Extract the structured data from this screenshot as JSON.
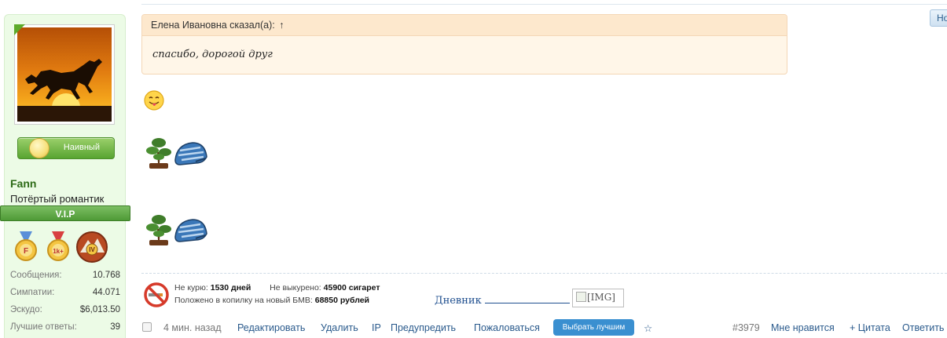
{
  "user": {
    "name": "Fann",
    "title": "Потёртый романтик",
    "mood_label": "Наивный",
    "rank_badge": "V.I.P",
    "stats": [
      {
        "label": "Сообщения:",
        "value": "10.768"
      },
      {
        "label": "Симпатии:",
        "value": "44.071"
      },
      {
        "label": "Эскудо:",
        "value": "$6,013.50"
      },
      {
        "label": "Лучшие ответы:",
        "value": "39"
      }
    ]
  },
  "quote": {
    "author_line": "Елена Ивановна сказал(а):",
    "arrow": "↑",
    "text": "спасибо, дорогой друг"
  },
  "top_right_button": "Но",
  "signature": {
    "not_smoking_label": "Не курю:",
    "not_smoking_value": "1530 дней",
    "not_smoked_label": "Не выкурено:",
    "not_smoked_value": "45900 сигарет",
    "saved_label": "Положено в копилку на новый БМВ:",
    "saved_value": "68850 рублей",
    "diary_label": "Дневник",
    "img_alt": "[IMG]"
  },
  "footer": {
    "time": "4 мин. назад",
    "edit": "Редактировать",
    "delete": "Удалить",
    "ip": "IP",
    "warn": "Предупредить",
    "report": "Пожаловаться",
    "best": "Выбрать лучшим",
    "star": "☆",
    "post_number": "#3979",
    "like": "Мне нравится",
    "quote": "+ Цитата",
    "reply": "Ответить"
  },
  "colors": {
    "panel_bg": "#ecfbe6",
    "quote_bg": "#fff6e8",
    "link": "#2a5a8c",
    "button_blue": "#3a8fd0",
    "vip_green": "#4e9a36"
  }
}
